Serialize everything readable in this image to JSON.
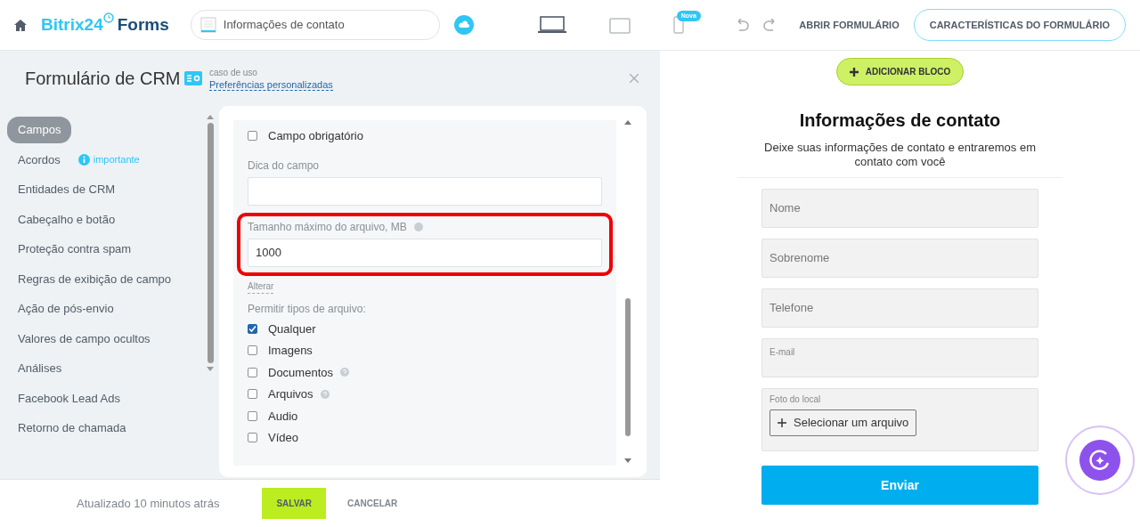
{
  "header": {
    "brand_main": "Bitrix24",
    "brand_sub": "Forms",
    "form_name": "Informações de contato",
    "devices": [
      {
        "kind": "desktop",
        "selected": true
      },
      {
        "kind": "tablet",
        "selected": false
      },
      {
        "kind": "phone",
        "selected": false,
        "badge": "Nova"
      }
    ],
    "open_link": "ABRIR FORMULÁRIO",
    "features_button": "CARACTERÍSTICAS DO FORMULÁRIO"
  },
  "panel": {
    "title": "Formulário de CRM",
    "use_case_label": "caso de uso",
    "use_case_link": "Preferências personalizadas"
  },
  "sidebar": {
    "items": [
      {
        "label": "Campos",
        "selected": true
      },
      {
        "label": "Acordos",
        "selected": false,
        "note": "importante"
      },
      {
        "label": "Entidades de CRM",
        "selected": false
      },
      {
        "label": "Cabeçalho e botão",
        "selected": false
      },
      {
        "label": "Proteção contra spam",
        "selected": false
      },
      {
        "label": "Regras de exibição de campo",
        "selected": false
      },
      {
        "label": "Ação de pós-envio",
        "selected": false
      },
      {
        "label": "Valores de campo ocultos",
        "selected": false
      },
      {
        "label": "Análises",
        "selected": false
      },
      {
        "label": "Facebook Lead Ads",
        "selected": false
      },
      {
        "label": "Retorno de chamada",
        "selected": false
      }
    ]
  },
  "settings": {
    "required": {
      "label": "Campo obrigatório",
      "checked": false
    },
    "hint_label": "Dica do campo",
    "max_size": {
      "label": "Tamanho máximo do arquivo, MB",
      "value": "1000",
      "highlighted": true
    },
    "change_link": "Alterar",
    "types_label": "Permitir tipos de arquivo:",
    "types": [
      {
        "label": "Qualquer",
        "checked": true,
        "help": false
      },
      {
        "label": "Imagens",
        "checked": false,
        "help": false
      },
      {
        "label": "Documentos",
        "checked": false,
        "help": true
      },
      {
        "label": "Arquivos",
        "checked": false,
        "help": true
      },
      {
        "label": "Audio",
        "checked": false,
        "help": false
      },
      {
        "label": "Vídeo",
        "checked": false,
        "help": false
      }
    ]
  },
  "footer": {
    "updated": "Atualizado 10 minutos atrás",
    "save": "SALVAR",
    "cancel": "CANCELAR"
  },
  "preview": {
    "add_block": "ADICIONAR BLOCO",
    "title": "Informações de contato",
    "subtitle": "Deixe suas informações de contato e entraremos em contato com você",
    "fields": [
      {
        "kind": "text",
        "placeholder": "Nome"
      },
      {
        "kind": "text",
        "placeholder": "Sobrenome"
      },
      {
        "kind": "text",
        "placeholder": "Telefone"
      },
      {
        "kind": "labeled",
        "label": "E-mail"
      },
      {
        "kind": "file",
        "label": "Foto do local",
        "button": "Selecionar um arquivo"
      }
    ],
    "submit": "Enviar"
  }
}
